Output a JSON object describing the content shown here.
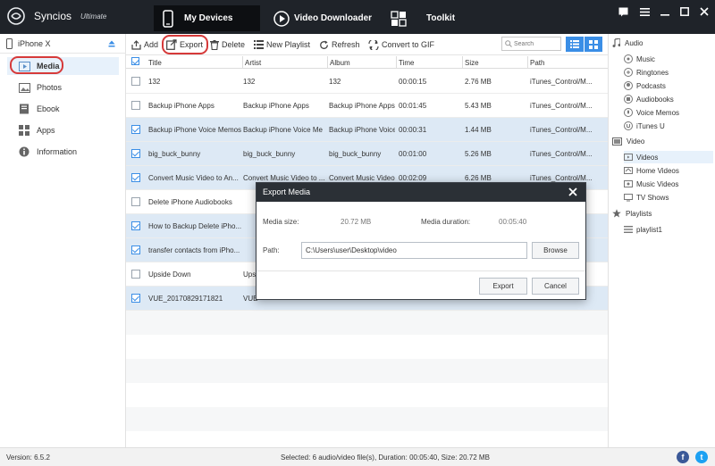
{
  "app": {
    "name": "Syncios",
    "edition": "Ultimate"
  },
  "nav": [
    {
      "label": "My Devices",
      "icon": "phone-icon"
    },
    {
      "label": "Video Downloader",
      "icon": "play-icon"
    },
    {
      "label": "Toolkit",
      "icon": "toolkit-icon"
    }
  ],
  "device": {
    "name": "iPhone X"
  },
  "sidebar": {
    "items": [
      {
        "label": "Media",
        "icon": "media-icon"
      },
      {
        "label": "Photos",
        "icon": "photos-icon"
      },
      {
        "label": "Ebook",
        "icon": "ebook-icon"
      },
      {
        "label": "Apps",
        "icon": "apps-icon"
      },
      {
        "label": "Information",
        "icon": "info-icon"
      }
    ]
  },
  "toolbar": {
    "add": "Add",
    "export": "Export",
    "delete": "Delete",
    "new_playlist": "New Playlist",
    "refresh": "Refresh",
    "convert": "Convert to GIF",
    "search_placeholder": "Search"
  },
  "table": {
    "columns": [
      "Title",
      "Artist",
      "Album",
      "Time",
      "Size",
      "Path"
    ],
    "rows": [
      {
        "selected": false,
        "title": "132",
        "artist": "132",
        "album": "132",
        "time": "00:00:15",
        "size": "2.76 MB",
        "path": "iTunes_Control/M..."
      },
      {
        "selected": false,
        "title": "Backup iPhone Apps",
        "artist": "Backup iPhone Apps",
        "album": "Backup iPhone Apps",
        "time": "00:01:45",
        "size": "5.43 MB",
        "path": "iTunes_Control/M..."
      },
      {
        "selected": true,
        "title": "Backup iPhone Voice Memos",
        "artist": "Backup iPhone Voice Me",
        "album": "Backup iPhone Voice...",
        "time": "00:00:31",
        "size": "1.44 MB",
        "path": "iTunes_Control/M..."
      },
      {
        "selected": true,
        "title": "big_buck_bunny",
        "artist": "big_buck_bunny",
        "album": "big_buck_bunny",
        "time": "00:01:00",
        "size": "5.26 MB",
        "path": "iTunes_Control/M..."
      },
      {
        "selected": true,
        "title": "Convert Music Video to An...",
        "artist": "Convert Music Video to ...",
        "album": "Convert Music Video ...",
        "time": "00:02:09",
        "size": "6.26 MB",
        "path": "iTunes_Control/M..."
      },
      {
        "selected": false,
        "title": "Delete iPhone Audiobooks",
        "artist": "",
        "album": "",
        "time": "",
        "size": "",
        "path": ""
      },
      {
        "selected": true,
        "title": "How to Backup Delete iPho...",
        "artist": "",
        "album": "",
        "time": "",
        "size": "",
        "path": ""
      },
      {
        "selected": true,
        "title": "transfer contacts from iPho...",
        "artist": "",
        "album": "",
        "time": "",
        "size": "",
        "path": ""
      },
      {
        "selected": false,
        "title": "Upside Down",
        "artist": "Ups",
        "album": "",
        "time": "",
        "size": "",
        "path": ""
      },
      {
        "selected": true,
        "title": "VUE_20170829171821",
        "artist": "VUE",
        "album": "",
        "time": "",
        "size": "",
        "path": ""
      }
    ]
  },
  "rpanel": {
    "audio": {
      "header": "Audio",
      "items": [
        "Music",
        "Ringtones",
        "Podcasts",
        "Audiobooks",
        "Voice Memos",
        "iTunes U"
      ]
    },
    "video": {
      "header": "Video",
      "items": [
        "Videos",
        "Home Videos",
        "Music Videos",
        "TV Shows"
      ]
    },
    "playlists": {
      "header": "Playlists",
      "items": [
        "playlist1"
      ]
    }
  },
  "dialog": {
    "title": "Export Media",
    "media_size_label": "Media size:",
    "media_size_value": "20.72 MB",
    "media_duration_label": "Media duration:",
    "media_duration_value": "00:05:40",
    "path_label": "Path:",
    "path_value": "C:\\Users\\user\\Desktop\\video",
    "browse": "Browse",
    "export": "Export",
    "cancel": "Cancel"
  },
  "status": {
    "version": "Version: 6.5.2",
    "summary": "Selected: 6 audio/video file(s), Duration: 00:05:40, Size: 20.72 MB"
  },
  "colors": {
    "titlebar": "#1f2329",
    "accent": "#3a8ee6",
    "selected_row": "#dde9f5",
    "highlight": "#d63a3a"
  }
}
